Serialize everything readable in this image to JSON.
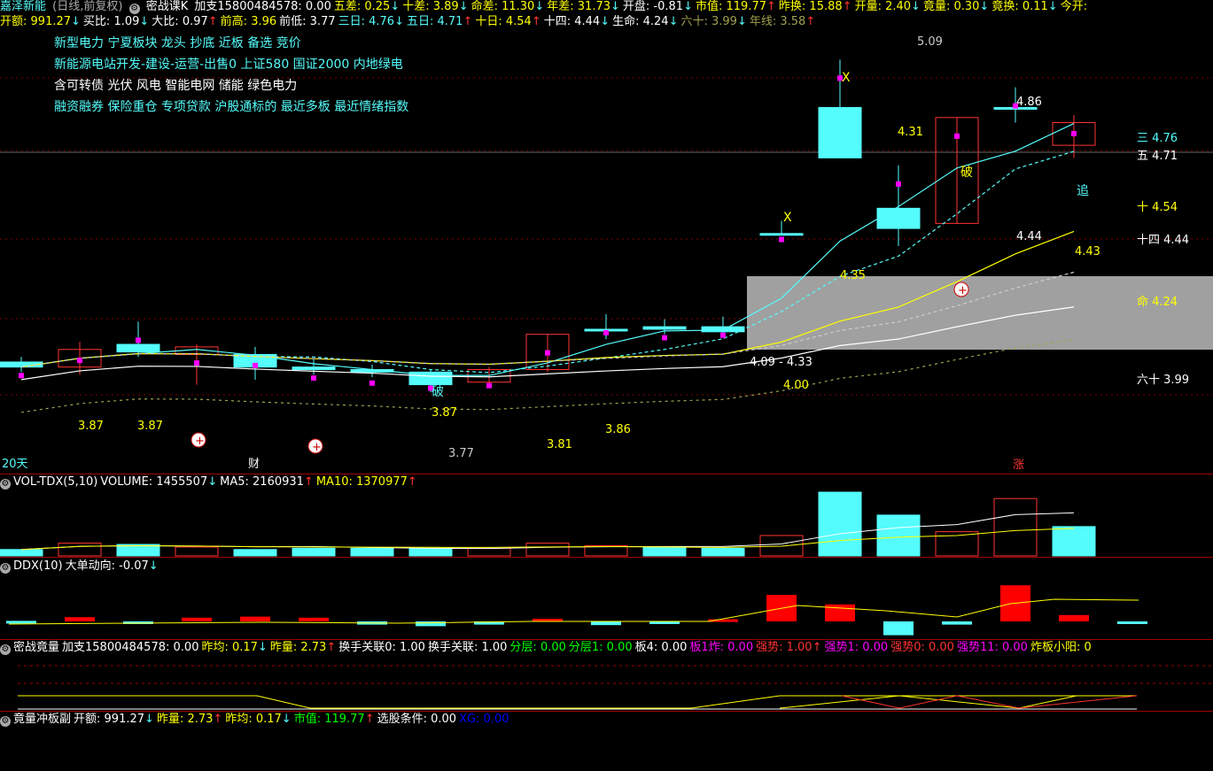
{
  "header": {
    "stock_name": "嘉泽新能",
    "period": "(日线,前复权)",
    "indicator": "密战课K",
    "fields": [
      {
        "label": "加支15800484578:",
        "value": "0.00",
        "cls": "wh",
        "arrow": ""
      },
      {
        "label": "五差:",
        "value": "0.25",
        "cls": "ye",
        "arrow": "↓"
      },
      {
        "label": "十差:",
        "value": "3.89",
        "cls": "ye",
        "arrow": "↓"
      },
      {
        "label": "命差:",
        "value": "11.30",
        "cls": "ye",
        "arrow": "↓"
      },
      {
        "label": "年差:",
        "value": "31.73",
        "cls": "ye",
        "arrow": "↓"
      },
      {
        "label": "开盘:",
        "value": "-0.81",
        "cls": "wh",
        "arrow": "↓"
      },
      {
        "label": "市值:",
        "value": "119.77",
        "cls": "ye",
        "arrow": "↑"
      },
      {
        "label": "昨换:",
        "value": "15.88",
        "cls": "ye",
        "arrow": "↑"
      },
      {
        "label": "开量:",
        "value": "2.40",
        "cls": "ye",
        "arrow": "↓"
      },
      {
        "label": "竟量:",
        "value": "0.30",
        "cls": "ye",
        "arrow": "↓"
      },
      {
        "label": "竟换:",
        "value": "0.11",
        "cls": "ye",
        "arrow": "↓"
      },
      {
        "label": "今开:",
        "value": "",
        "cls": "ye",
        "arrow": ""
      }
    ]
  },
  "row2": [
    {
      "label": "开额:",
      "value": "991.27",
      "cls": "ye",
      "arrow": "↓"
    },
    {
      "label": "买比:",
      "value": "1.09",
      "cls": "wh",
      "arrow": "↓"
    },
    {
      "label": "大比:",
      "value": "0.97",
      "cls": "wh",
      "arrow": "↑"
    },
    {
      "label": "前高:",
      "value": "3.96",
      "cls": "ye",
      "arrow": ""
    },
    {
      "label": "前低:",
      "value": "3.77",
      "cls": "wh",
      "arrow": ""
    },
    {
      "label": "三日:",
      "value": "4.76",
      "cls": "cy",
      "arrow": "↓"
    },
    {
      "label": "五日:",
      "value": "4.71",
      "cls": "cy",
      "arrow": "↑"
    },
    {
      "label": "十日:",
      "value": "4.54",
      "cls": "ye",
      "arrow": "↑"
    },
    {
      "label": "十四:",
      "value": "4.44",
      "cls": "wh",
      "arrow": "↓"
    },
    {
      "label": "生命:",
      "value": "4.24",
      "cls": "wh",
      "arrow": "↓"
    },
    {
      "label": "六十:",
      "value": "3.99",
      "cls": "ol",
      "arrow": "↓"
    },
    {
      "label": "年线:",
      "value": "3.58",
      "cls": "ol",
      "arrow": "↑"
    }
  ],
  "concepts": [
    {
      "text": "新型电力    宁夏板块    龙头 抄底 近板 备选 竞价",
      "cls": "cy"
    },
    {
      "text": "新能源电站开发-建设-运营-出售0 上证580 国证2000 内地绿电",
      "cls": "cy"
    },
    {
      "text": "含可转债 光伏 风电 智能电网 储能 绿色电力",
      "cls": "wh"
    },
    {
      "text": "融资融券 保险重仓 专项贷款 沪股通标的 最近多板 最近情绪指数",
      "cls": "cy"
    }
  ],
  "main_labels": {
    "period_marker": "20天",
    "cai": "财",
    "zhang": "涨",
    "po1": "破",
    "po2": "破",
    "zhui": "追",
    "x1": "X",
    "x2": "X",
    "high_peak": "5.09",
    "top_box": "4.86",
    "box_low": "4.44",
    "mid_label_435": "4.35",
    "mid_label_433": "4.09 - 4.33",
    "lbl_400": "4.00",
    "lbl_386": "3.86",
    "lbl_381": "3.81",
    "lbl_387a": "3.87",
    "lbl_387b": "3.87",
    "lbl_377": "3.77",
    "lbl_443": "4.43",
    "lbl_431": "4.31",
    "lbl_ke": "3.87",
    "right_ma": [
      {
        "label": "三 4.76",
        "cls": "cy"
      },
      {
        "label": "五 4.71",
        "cls": "wh"
      },
      {
        "label": "十 4.54",
        "cls": "ye"
      },
      {
        "label": "十四 4.44",
        "cls": "wh"
      },
      {
        "label": "命 4.24",
        "cls": "ye"
      },
      {
        "label": "六十 3.99",
        "cls": "wh"
      }
    ]
  },
  "vol_header": [
    {
      "label": "VOL-TDX(5,10)",
      "value": "",
      "cls": "wh",
      "arrow": ""
    },
    {
      "label": "VOLUME:",
      "value": "1455507",
      "cls": "wh",
      "arrow": "↓"
    },
    {
      "label": "MA5:",
      "value": "2160931",
      "cls": "wh",
      "arrow": "↑"
    },
    {
      "label": "MA10:",
      "value": "1370977",
      "cls": "ye",
      "arrow": "↑"
    }
  ],
  "ddx_header": [
    {
      "label": "DDX(10)",
      "value": "",
      "cls": "wh",
      "arrow": ""
    },
    {
      "label": "大单动向:",
      "value": "-0.07",
      "cls": "wh",
      "arrow": "↓"
    }
  ],
  "mzj_header": [
    {
      "label": "密战竟量",
      "value": "",
      "cls": "wh",
      "arrow": ""
    },
    {
      "label": "加支15800484578:",
      "value": "0.00",
      "cls": "wh",
      "arrow": ""
    },
    {
      "label": "昨均:",
      "value": "0.17",
      "cls": "ye",
      "arrow": "↓"
    },
    {
      "label": "昨量:",
      "value": "2.73",
      "cls": "ye",
      "arrow": "↑"
    },
    {
      "label": "换手关联0:",
      "value": "1.00",
      "cls": "wh",
      "arrow": ""
    },
    {
      "label": "换手关联:",
      "value": "1.00",
      "cls": "wh",
      "arrow": ""
    },
    {
      "label": "分层:",
      "value": "0.00",
      "cls": "gr",
      "arrow": ""
    },
    {
      "label": "分层1:",
      "value": "0.00",
      "cls": "gr",
      "arrow": ""
    },
    {
      "label": "板4:",
      "value": "0.00",
      "cls": "wh",
      "arrow": ""
    },
    {
      "label": "板1炸:",
      "value": "0.00",
      "cls": "mg",
      "arrow": ""
    },
    {
      "label": "强势:",
      "value": "1.00",
      "cls": "rd",
      "arrow": "↑"
    },
    {
      "label": "强势1:",
      "value": "0.00",
      "cls": "mg",
      "arrow": ""
    },
    {
      "label": "强势0:",
      "value": "0.00",
      "cls": "rd",
      "arrow": ""
    },
    {
      "label": "强势11:",
      "value": "0.00",
      "cls": "mg",
      "arrow": ""
    },
    {
      "label": "炸板小阳:",
      "value": "0",
      "cls": "ye",
      "arrow": ""
    }
  ],
  "jlcb_header": [
    {
      "label": "竟量冲板副",
      "value": "",
      "cls": "wh",
      "arrow": ""
    },
    {
      "label": "开额:",
      "value": "991.27",
      "cls": "wh",
      "arrow": "↓"
    },
    {
      "label": "昨量:",
      "value": "2.73",
      "cls": "ye",
      "arrow": "↑"
    },
    {
      "label": "昨均:",
      "value": "0.17",
      "cls": "ye",
      "arrow": "↓"
    },
    {
      "label": "市值:",
      "value": "119.77",
      "cls": "gr",
      "arrow": "↑"
    },
    {
      "label": "选股条件:",
      "value": "0.00",
      "cls": "wh",
      "arrow": ""
    },
    {
      "label": "XG:",
      "value": "0.00",
      "cls": "bl",
      "arrow": ""
    }
  ],
  "colors": {
    "up": "#ff3333",
    "down": "#54fcfc",
    "ma3": "#54fcfc",
    "ma10": "#ffff00",
    "ma14": "#ffffff",
    "ma60": "#a0a050",
    "zone": "#a0a0a0"
  },
  "chart_data": [
    {
      "type": "candlestick",
      "title": "嘉泽新能 (日线,前复权)",
      "ylim": [
        3.5,
        5.2
      ],
      "candles": [
        {
          "o": 3.89,
          "h": 3.91,
          "l": 3.85,
          "c": 3.87,
          "up": false
        },
        {
          "o": 3.87,
          "h": 3.97,
          "l": 3.84,
          "c": 3.94,
          "up": true
        },
        {
          "o": 3.93,
          "h": 4.05,
          "l": 3.91,
          "c": 3.96,
          "up": false
        },
        {
          "o": 3.95,
          "h": 3.96,
          "l": 3.8,
          "c": 3.92,
          "up": true
        },
        {
          "o": 3.92,
          "h": 3.95,
          "l": 3.82,
          "c": 3.87,
          "up": false
        },
        {
          "o": 3.87,
          "h": 3.9,
          "l": 3.84,
          "c": 3.86,
          "up": false
        },
        {
          "o": 3.86,
          "h": 3.88,
          "l": 3.83,
          "c": 3.85,
          "up": false
        },
        {
          "o": 3.85,
          "h": 3.86,
          "l": 3.77,
          "c": 3.8,
          "up": false
        },
        {
          "o": 3.81,
          "h": 3.87,
          "l": 3.79,
          "c": 3.86,
          "up": true
        },
        {
          "o": 3.86,
          "h": 4.0,
          "l": 3.85,
          "c": 4.0,
          "up": true
        },
        {
          "o": 4.02,
          "h": 4.08,
          "l": 3.98,
          "c": 4.02,
          "up": false
        },
        {
          "o": 4.03,
          "h": 4.06,
          "l": 4.0,
          "c": 4.02,
          "up": false
        },
        {
          "o": 4.03,
          "h": 4.07,
          "l": 3.99,
          "c": 4.01,
          "up": false
        },
        {
          "o": 4.4,
          "h": 4.45,
          "l": 4.4,
          "c": 4.4,
          "up": false
        },
        {
          "o": 4.9,
          "h": 5.09,
          "l": 4.7,
          "c": 4.7,
          "up": false
        },
        {
          "o": 4.5,
          "h": 4.67,
          "l": 4.35,
          "c": 4.42,
          "up": false
        },
        {
          "o": 4.44,
          "h": 4.86,
          "l": 4.44,
          "c": 4.86,
          "up": true
        },
        {
          "o": 4.9,
          "h": 4.98,
          "l": 4.84,
          "c": 4.9,
          "up": false
        },
        {
          "o": 4.84,
          "h": 4.87,
          "l": 4.7,
          "c": 4.75,
          "up": true
        }
      ]
    },
    {
      "type": "bar",
      "title": "VOL-TDX(5,10)",
      "values": [
        0.1,
        0.2,
        0.18,
        0.14,
        0.1,
        0.12,
        0.12,
        0.12,
        0.12,
        0.2,
        0.16,
        0.14,
        0.12,
        0.32,
        1.0,
        0.64,
        0.38,
        0.9,
        0.46
      ],
      "up": [
        false,
        true,
        false,
        true,
        false,
        false,
        false,
        false,
        true,
        true,
        true,
        false,
        false,
        true,
        false,
        false,
        true,
        true,
        false
      ]
    },
    {
      "type": "bar",
      "title": "DDX(10)",
      "values": [
        0.01,
        0.08,
        -0.05,
        0.07,
        0.09,
        0.07,
        -0.06,
        -0.09,
        -0.06,
        0.05,
        -0.07,
        -0.05,
        0.04,
        0.5,
        0.32,
        -0.26,
        -0.06,
        0.68,
        0.12,
        -0.05
      ],
      "up": [
        false,
        true,
        false,
        true,
        true,
        true,
        false,
        false,
        false,
        true,
        false,
        false,
        true,
        true,
        true,
        false,
        false,
        true,
        true,
        false
      ]
    }
  ]
}
